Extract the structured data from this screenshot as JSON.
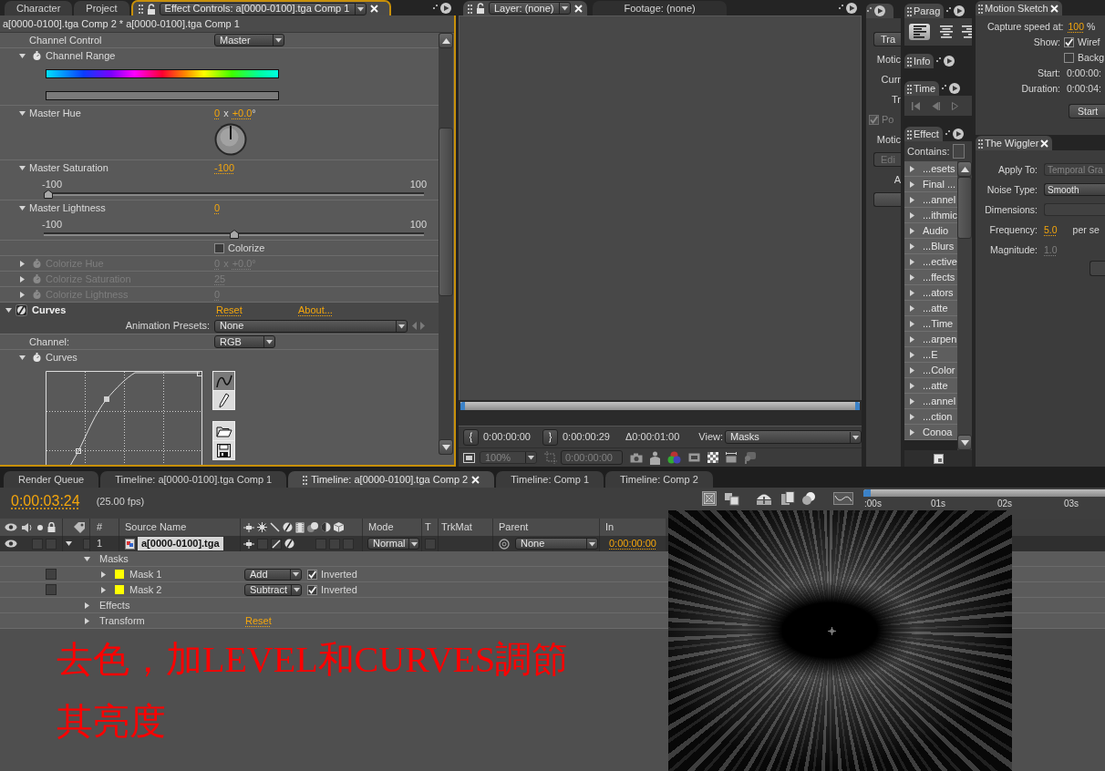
{
  "effect_controls": {
    "tabs": [
      {
        "label": "Character",
        "selected": false
      },
      {
        "label": "Project",
        "selected": false
      },
      {
        "label": "Effect Controls: a[0000-0100].tga Comp 1",
        "selected": true
      }
    ],
    "breadcrumb": "a[0000-0100].tga Comp 2 * a[0000-0100].tga Comp 1",
    "params": [
      {
        "kind": "dropdown",
        "label": "Channel Control",
        "value": "Master",
        "stopwatch": false,
        "disabled": false
      },
      {
        "kind": "range",
        "label": "Channel Range",
        "expanded": true,
        "stopwatch": true,
        "disabled": false
      },
      {
        "kind": "angle",
        "label": "Master Hue",
        "expanded": true,
        "stopwatch": false,
        "disabled": false,
        "turns": "0",
        "times": "x",
        "degrees": "+0.0",
        "unit": "°"
      },
      {
        "kind": "slider",
        "label": "Master Saturation",
        "expanded": true,
        "stopwatch": false,
        "disabled": false,
        "value": "-100",
        "min": "-100",
        "max": "100",
        "level": 0
      },
      {
        "kind": "slider",
        "label": "Master Lightness",
        "expanded": true,
        "stopwatch": false,
        "disabled": false,
        "value": "0",
        "min": "-100",
        "max": "100",
        "level": 0.5
      },
      {
        "kind": "checkbox",
        "label": "Colorize",
        "checked": false,
        "stopwatch": false,
        "disabled": false
      },
      {
        "kind": "angle",
        "label": "Colorize Hue",
        "expanded": false,
        "stopwatch": true,
        "disabled": true,
        "turns": "0",
        "times": "x",
        "degrees": "+0.0",
        "unit": "°"
      },
      {
        "kind": "number",
        "label": "Colorize Saturation",
        "expanded": false,
        "stopwatch": true,
        "disabled": true,
        "value": "25"
      },
      {
        "kind": "number",
        "label": "Colorize Lightness",
        "expanded": false,
        "stopwatch": true,
        "disabled": true,
        "value": "0"
      }
    ],
    "effect": {
      "name": "Curves",
      "expanded": true,
      "reset": "Reset",
      "about": "About...",
      "presets_label": "Animation Presets:",
      "presets_value": "None",
      "params": [
        {
          "kind": "dropdown",
          "label": "Channel:",
          "value": "RGB",
          "stopwatch": false,
          "disabled": false
        },
        {
          "kind": "curves",
          "label": "Curves",
          "expanded": true,
          "stopwatch": true,
          "disabled": false,
          "tools": [
            {
              "kind": "bezier",
              "selected": true
            },
            {
              "kind": "pencil",
              "selected": false
            }
          ]
        }
      ]
    }
  },
  "viewer": {
    "tabs": [
      {
        "label": "Layer: (none)",
        "selected": true
      },
      {
        "label": "Footage: (none)",
        "selected": false
      }
    ],
    "in_time": "0:00:00:00",
    "out_time": "0:00:00:29",
    "duration": "Δ0:00:01:00",
    "view_label": "View:",
    "view_value": "Masks",
    "zoom": {
      "value": "100%",
      "disabled": true
    },
    "current_time": {
      "value": "0:00:00:00",
      "disabled": true
    }
  },
  "tracker": {
    "items": [
      {
        "kind": "button",
        "text": "Tra",
        "disabled": false
      },
      {
        "kind": "label",
        "text": "Motic"
      },
      {
        "kind": "label",
        "text": "Curr"
      },
      {
        "kind": "label",
        "text": "Tr"
      },
      {
        "kind": "checkbox",
        "text": "Po",
        "checked": true,
        "disabled": true
      },
      {
        "kind": "label",
        "text": "Motic"
      },
      {
        "kind": "button",
        "text": "Edi",
        "disabled": true
      },
      {
        "kind": "label",
        "text": "A"
      }
    ]
  },
  "paragraph": {
    "title": "Parag",
    "align": [
      {
        "kind": "left",
        "selected": true
      },
      {
        "kind": "center",
        "selected": false
      },
      {
        "kind": "right",
        "selected": false
      }
    ]
  },
  "info": {
    "title": "Info"
  },
  "time_controls": {
    "title": "Time"
  },
  "effects_presets": {
    "title": "Effect",
    "contains_label": "Contains:",
    "items": [
      {
        "label": "...esets",
        "expanded": false
      },
      {
        "label": "Final ...",
        "expanded": false
      },
      {
        "label": "...annel",
        "expanded": false
      },
      {
        "label": "...ithmic",
        "expanded": false
      },
      {
        "label": "Audio",
        "expanded": false
      },
      {
        "label": "...Blurs",
        "expanded": false
      },
      {
        "label": "...ective",
        "expanded": false
      },
      {
        "label": "...ffects",
        "expanded": false
      },
      {
        "label": "...ators",
        "expanded": false
      },
      {
        "label": "...atte",
        "expanded": false
      },
      {
        "label": "...Time",
        "expanded": false
      },
      {
        "label": "...arpen",
        "expanded": false
      },
      {
        "label": "...E",
        "expanded": false
      },
      {
        "label": "...Color",
        "expanded": false
      },
      {
        "label": "...atte",
        "expanded": false
      },
      {
        "label": "...annel",
        "expanded": false
      },
      {
        "label": "...ction",
        "expanded": false
      },
      {
        "label": "Conoa",
        "expanded": false
      }
    ]
  },
  "motion_sketch": {
    "title": "Motion Sketch",
    "capture_label": "Capture speed at:",
    "capture_value": "100",
    "capture_unit": "%",
    "show_label": "Show:",
    "options": [
      {
        "label": "Wiref",
        "checked": true
      },
      {
        "label": "Backg",
        "checked": false
      }
    ],
    "start_label": "Start:",
    "start_value": "0:00:00:",
    "duration_label": "Duration:",
    "duration_value": "0:00:04:",
    "start_button": "Start"
  },
  "wiggler": {
    "title": "The Wiggler",
    "fields": [
      {
        "kind": "dropdown",
        "label": "Apply To:",
        "value": "Temporal Gra",
        "disabled": true
      },
      {
        "kind": "dropdown",
        "label": "Noise Type:",
        "value": "Smooth",
        "disabled": false
      },
      {
        "kind": "dropdown",
        "label": "Dimensions:",
        "disabled": true
      },
      {
        "kind": "number",
        "label": "Frequency:",
        "value": "5.0",
        "unit": "per se",
        "disabled": false
      },
      {
        "kind": "number",
        "label": "Magnitude:",
        "value": "1.0",
        "disabled": true
      }
    ]
  },
  "timeline": {
    "tabs": [
      {
        "label": "Render Queue",
        "selected": false
      },
      {
        "label": "Timeline: a[0000-0100].tga Comp 1",
        "selected": false
      },
      {
        "label": "Timeline: a[0000-0100].tga Comp 2",
        "selected": true
      },
      {
        "label": "Timeline: Comp 1",
        "selected": false
      },
      {
        "label": "Timeline: Comp 2",
        "selected": false
      }
    ],
    "current_time": "0:00:03:24",
    "fps": "(25.00 fps)",
    "ruler": [
      ":00s",
      "01s",
      "02s",
      "03s"
    ],
    "headers": {
      "number": "#",
      "source_name": "Source Name",
      "mode": "Mode",
      "t": "T",
      "trkmat": "TrkMat",
      "parent": "Parent",
      "in": "In"
    },
    "layer": {
      "number": "1",
      "name": "a[0000-0100].tga",
      "selected": true,
      "expanded": true,
      "visible": true,
      "mode": "Normal",
      "parent": "None",
      "in": "0:00:00:00"
    },
    "properties": [
      {
        "kind": "group",
        "label": "Masks",
        "expanded": true,
        "children": [
          {
            "kind": "mask",
            "label": "Mask 1",
            "color": "#ffff00",
            "expanded": false,
            "mode": "Add",
            "inverted": true,
            "inverted_label": "Inverted"
          },
          {
            "kind": "mask",
            "label": "Mask 2",
            "color": "#ffff00",
            "expanded": false,
            "mode": "Subtract",
            "inverted": true,
            "inverted_label": "Inverted"
          }
        ]
      },
      {
        "kind": "group",
        "label": "Effects",
        "expanded": false
      },
      {
        "kind": "group",
        "label": "Transform",
        "expanded": false,
        "reset": "Reset"
      }
    ]
  },
  "annotation": {
    "lines": [
      "去色，加LEVEL和CURVES調節",
      "其亮度"
    ]
  }
}
